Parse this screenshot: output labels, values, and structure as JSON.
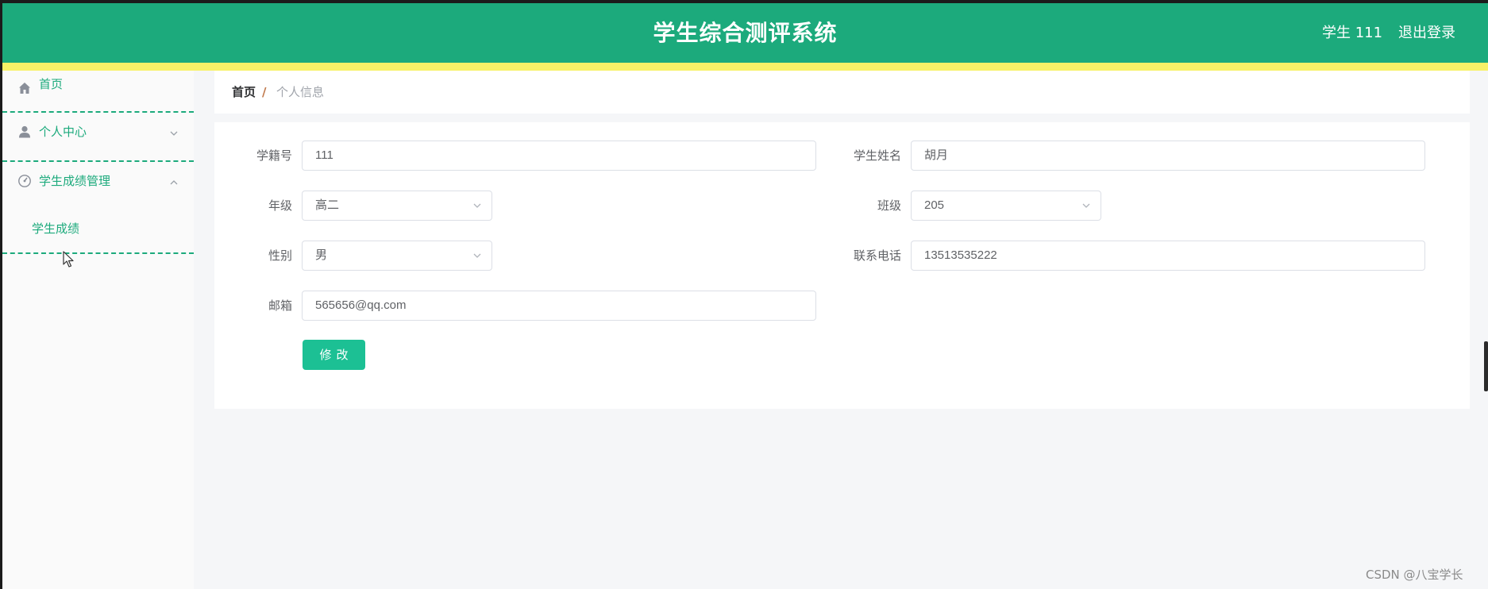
{
  "header": {
    "title": "学生综合测评系统",
    "user": "学生 111",
    "logout": "退出登录",
    "colors": {
      "bar": "#1caa7c",
      "stripe": "#f8f167"
    }
  },
  "sidebar": {
    "items": [
      {
        "label": "首页",
        "icon": "home-icon"
      },
      {
        "label": "个人中心",
        "icon": "user-icon",
        "expanded": false
      },
      {
        "label": "学生成绩管理",
        "icon": "dashboard-icon",
        "expanded": true,
        "children": [
          {
            "label": "学生成绩"
          }
        ]
      }
    ],
    "accent": "#1caa7c"
  },
  "breadcrumb": {
    "home": "首页",
    "separator": "/",
    "current": "个人信息"
  },
  "form": {
    "student_no": {
      "label": "学籍号",
      "value": "111"
    },
    "student_name": {
      "label": "学生姓名",
      "value": "胡月"
    },
    "grade": {
      "label": "年级",
      "value": "高二"
    },
    "class": {
      "label": "班级",
      "value": "205"
    },
    "gender": {
      "label": "性别",
      "value": "男"
    },
    "phone": {
      "label": "联系电话",
      "value": "13513535222"
    },
    "email": {
      "label": "邮箱",
      "value": "565656@qq.com"
    },
    "submit": "修改",
    "submit_color": "#1cc094"
  },
  "watermark": "CSDN @八宝学长"
}
